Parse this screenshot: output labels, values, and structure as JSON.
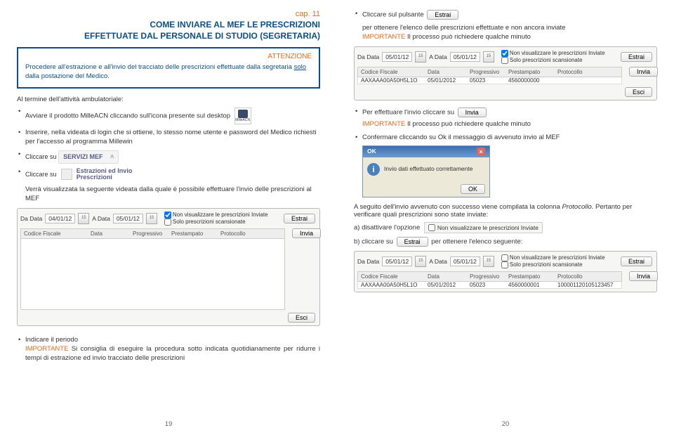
{
  "left": {
    "cap": "cap. 11",
    "title_l1": "COME INVIARE AL MEF LE PRESCRIZIONI",
    "title_l2": "EFFETTUATE DAL PERSONALE DI STUDIO (SEGRETARIA)",
    "attention_label": "ATTENZIONE",
    "attention_text_pre": "Procedere all'estrazione e all'invio del tracciato delle prescrizioni effettuate dalla segretaria ",
    "attention_underline": "solo",
    "attention_text_post": " dalla postazione del Medico.",
    "section_intro": "Al termine dell'attività ambulatoriale:",
    "b1": "Avviare il prodotto MilleACN cliccando sull'icona presente sul desktop",
    "milleacn_label": "MilleACN",
    "b2": "Inserire, nella videata di login che si ottiene, lo stesso nome utente e password del Medico richiesti per l'accesso al programma Millewin",
    "b3": "Cliccare su",
    "servizi_mef": "SERVIZI MEF",
    "b4": "Cliccare su",
    "estraz_l1": "Estrazioni ed Invio",
    "estraz_l2": "Prescrizioni",
    "post_text": "Verrà visualizzata la seguente videata dalla quale è possibile effettuare l'invio delle prescrizioni al MEF",
    "panel": {
      "da_data": "Da Data",
      "a_data": "A Data",
      "date1": "04/01/12",
      "date2": "05/01/12",
      "cal": "15",
      "chk1": "Non visualizzare le prescrizioni Inviate",
      "chk2": "Solo prescrizioni scansionate",
      "estrai": "Estrai",
      "h_cf": "Codice Fiscale",
      "h_dt": "Data",
      "h_pr": "Progressivo",
      "h_ps": "Prestampato",
      "h_pt": "Protocollo",
      "invia": "Invia",
      "esci": "Esci"
    },
    "bottom": {
      "b1": "Indicare il periodo",
      "b1_imp": "IMPORTANTE",
      "b1_txt": " Si consiglia di eseguire la procedura sotto indicata quotidianamente per ridurre i tempi di estrazione ed invio tracciato delle prescrizioni"
    },
    "pagenum": "19"
  },
  "right": {
    "b1": "Cliccare sul pulsante",
    "estrai": "Estrai",
    "b1_txt": "per ottenere l'elenco delle prescrizioni effettuate e non ancora inviate",
    "b1_imp": "IMPORTANTE",
    "b1_imp_txt": " Il processo può richiedere qualche minuto",
    "panel1": {
      "date1": "05/01/12",
      "date2": "05/01/12",
      "row_cf": "AAXAAA00A50H5L1O",
      "row_dt": "05/01/2012",
      "row_pr": "05023",
      "row_ps": "4560000000",
      "row_pt": ""
    },
    "b2": "Per effettuare l'invio cliccare su",
    "invia": "Invia",
    "b2_imp": "IMPORTANTE",
    "b2_imp_txt": " Il processo può richiedere qualche minuto",
    "b3": "Confermare cliccando su Ok il messaggio di avvenuto invio al MEF",
    "ok_title": "OK",
    "ok_msg": "Invio dati effettuato correttamente",
    "ok_btn": "OK",
    "after_ok_1": "A seguito dell'invio avvenuto con successo viene compilata la colonna ",
    "after_ok_em": "Protocollo",
    "after_ok_2": ". Pertanto per verificare quali prescrizioni sono state inviate:",
    "step_a": "a) disattivare l'opzione",
    "chk_label": "Non visualizzare le prescrizioni Inviate",
    "step_b_pre": "b) cliccare su",
    "step_b_post": "per ottenere l'elenco seguente:",
    "panel2": {
      "date1": "05/01/12",
      "date2": "05/01/12",
      "row_cf": "AAXAAA00A50H5L1O",
      "row_dt": "05/01/2012",
      "row_pr": "05023",
      "row_ps": "4560000001",
      "row_pt": "100001120105123457"
    },
    "pagenum": "20"
  }
}
